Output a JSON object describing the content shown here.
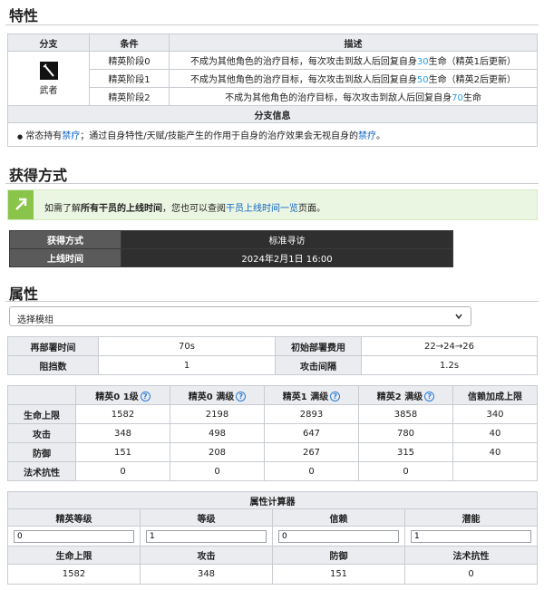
{
  "sections": {
    "traits_title": "特性",
    "acquire_title": "获得方式",
    "attributes_title": "属性"
  },
  "traits": {
    "headers": [
      "分支",
      "条件",
      "描述"
    ],
    "branch_name": "武者",
    "rows": [
      {
        "cond": "精英阶段0",
        "desc_pre": "不成为其他角色的治疗目标，每次攻击到敌人后回复自身",
        "value": "30",
        "desc_post": "生命（精英1后更新）"
      },
      {
        "cond": "精英阶段1",
        "desc_pre": "不成为其他角色的治疗目标，每次攻击到敌人后回复自身",
        "value": "50",
        "desc_post": "生命（精英2后更新）"
      },
      {
        "cond": "精英阶段2",
        "desc_pre": "不成为其他角色的治疗目标，每次攻击到敌人后回复自身",
        "value": "70",
        "desc_post": "生命"
      }
    ],
    "info_header": "分支信息",
    "info_pre": "常态持有",
    "info_link1": "禁疗",
    "info_mid": "；通过自身特性/天赋/技能产生的作用于自身的治疗效果会无视自身的",
    "info_link2": "禁疗",
    "info_post": "。"
  },
  "notice": {
    "pre": "如需了解",
    "bold": "所有干员的上线时间",
    "mid": "，您也可以查阅",
    "link": "干员上线时间一览",
    "post": "页面。"
  },
  "acquire": {
    "method_label": "获得方式",
    "method_value": "标准寻访",
    "date_label": "上线时间",
    "date_value": "2024年2月1日 16:00"
  },
  "module_select": {
    "selected": "选择模组"
  },
  "deploy": {
    "redeploy_label": "再部署时间",
    "redeploy_value": "70s",
    "cost_label": "初始部署费用",
    "cost_value": "22→24→26",
    "block_label": "阻挡数",
    "block_value": "1",
    "interval_label": "攻击间隔",
    "interval_value": "1.2s"
  },
  "stats": {
    "headers": [
      "精英0 1级",
      "精英0 满级",
      "精英1 满级",
      "精英2 满级",
      "信赖加成上限"
    ],
    "rows": [
      {
        "label": "生命上限",
        "values": [
          "1582",
          "2198",
          "2893",
          "3858",
          "340"
        ]
      },
      {
        "label": "攻击",
        "values": [
          "348",
          "498",
          "647",
          "780",
          "40"
        ]
      },
      {
        "label": "防御",
        "values": [
          "151",
          "208",
          "267",
          "315",
          "40"
        ]
      },
      {
        "label": "法术抗性",
        "values": [
          "0",
          "0",
          "0",
          "0",
          ""
        ]
      }
    ]
  },
  "calculator": {
    "title": "属性计算器",
    "input_labels": [
      "精英等级",
      "等级",
      "信赖",
      "潜能"
    ],
    "input_values": [
      "0",
      "1",
      "0",
      "1"
    ],
    "output_labels": [
      "生命上限",
      "攻击",
      "防御",
      "法术抗性"
    ],
    "output_values": [
      "1582",
      "348",
      "151",
      "0"
    ]
  }
}
